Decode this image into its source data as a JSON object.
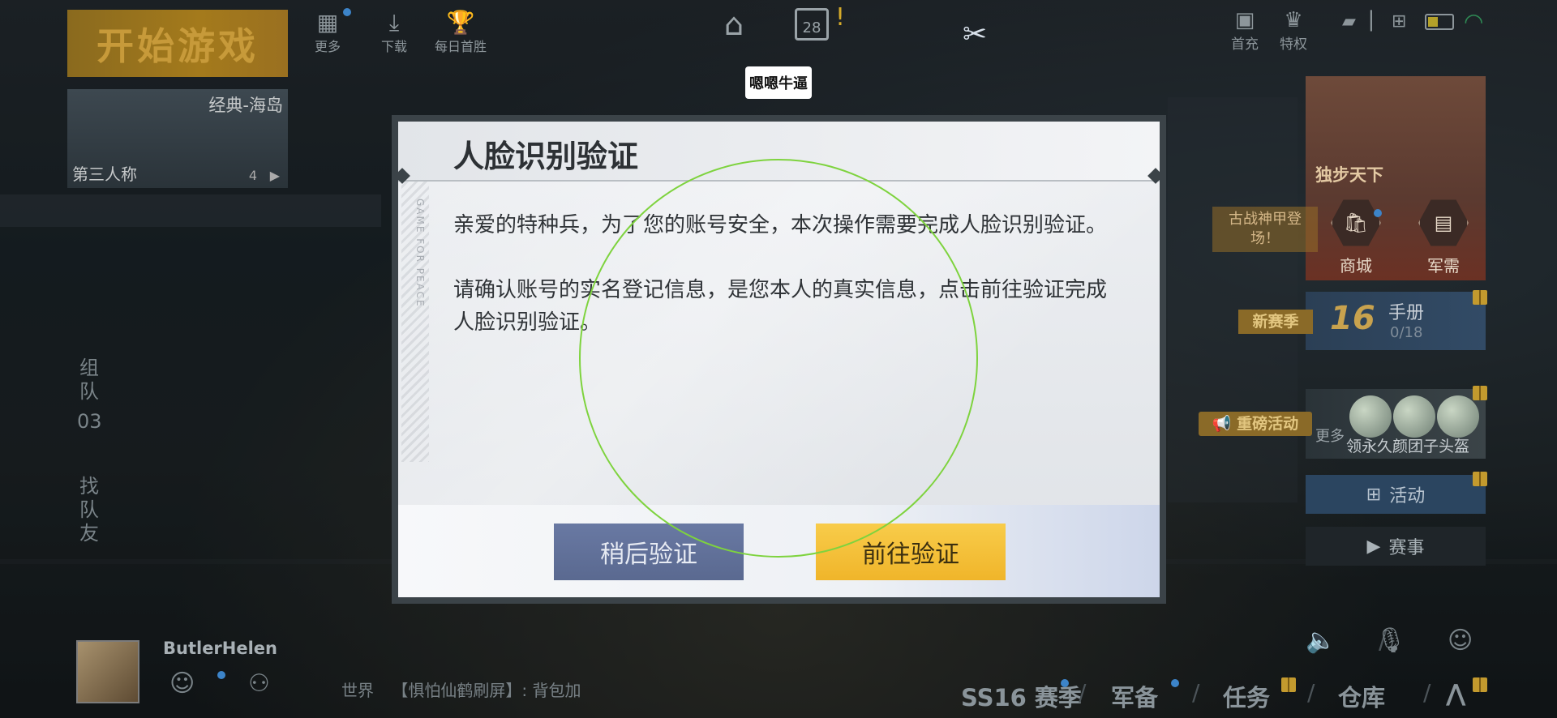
{
  "top_left": {
    "start_game": "开始游戏",
    "map_mode": "经典-海岛",
    "view_mode": "第三人称",
    "map_num": "4",
    "icons": [
      {
        "label": "更多",
        "icon": "more-icon"
      },
      {
        "label": "下载",
        "icon": "download-icon"
      },
      {
        "label": "每日首胜",
        "icon": "trophy-icon"
      }
    ]
  },
  "top_center": {
    "calendar_day": "28",
    "tag_text": "嗯嗯牛逼"
  },
  "top_right": {
    "first_charge": "首充",
    "privilege": "特权"
  },
  "left_side": {
    "team_chars": [
      "组",
      "队"
    ],
    "team_count": "03",
    "find_chars": [
      "找",
      "队",
      "友"
    ]
  },
  "right_panel": {
    "promo_title": "独步天下",
    "shop": "商城",
    "military": "军需",
    "mecha_tag": "古战神甲登场！",
    "new_season_badge": "新赛季",
    "season_level": "16",
    "handbook": "手册",
    "handbook_progress": "0/18",
    "broadcast": "重磅活动",
    "event_more": "更多",
    "event_text": "领永久颜团子头盔",
    "activities": "活动",
    "matches": "赛事"
  },
  "bottom_bar": {
    "username": "ButlerHelen",
    "chat_channel": "世界",
    "chat_message": "【惧怕仙鹤刷屏】: 背包加",
    "nav": [
      "SS16 赛季",
      "军备",
      "任务",
      "仓库"
    ]
  },
  "modal": {
    "title": "人脸识别验证",
    "watermark": "GAME FOR PEACE",
    "paragraph1": "亲爱的特种兵，为了您的账号安全，本次操作需要完成人脸识别验证。",
    "paragraph2": "请确认账号的实名登记信息，是您本人的真实信息，点击前往验证完成人脸识别验证。",
    "later_button": "稍后验证",
    "go_button": "前往验证"
  },
  "colors": {
    "primary_button": "#f3bd35",
    "secondary_button": "#5f6e96",
    "face_circle": "#7ed33e",
    "start_button": "#a47a1c"
  }
}
